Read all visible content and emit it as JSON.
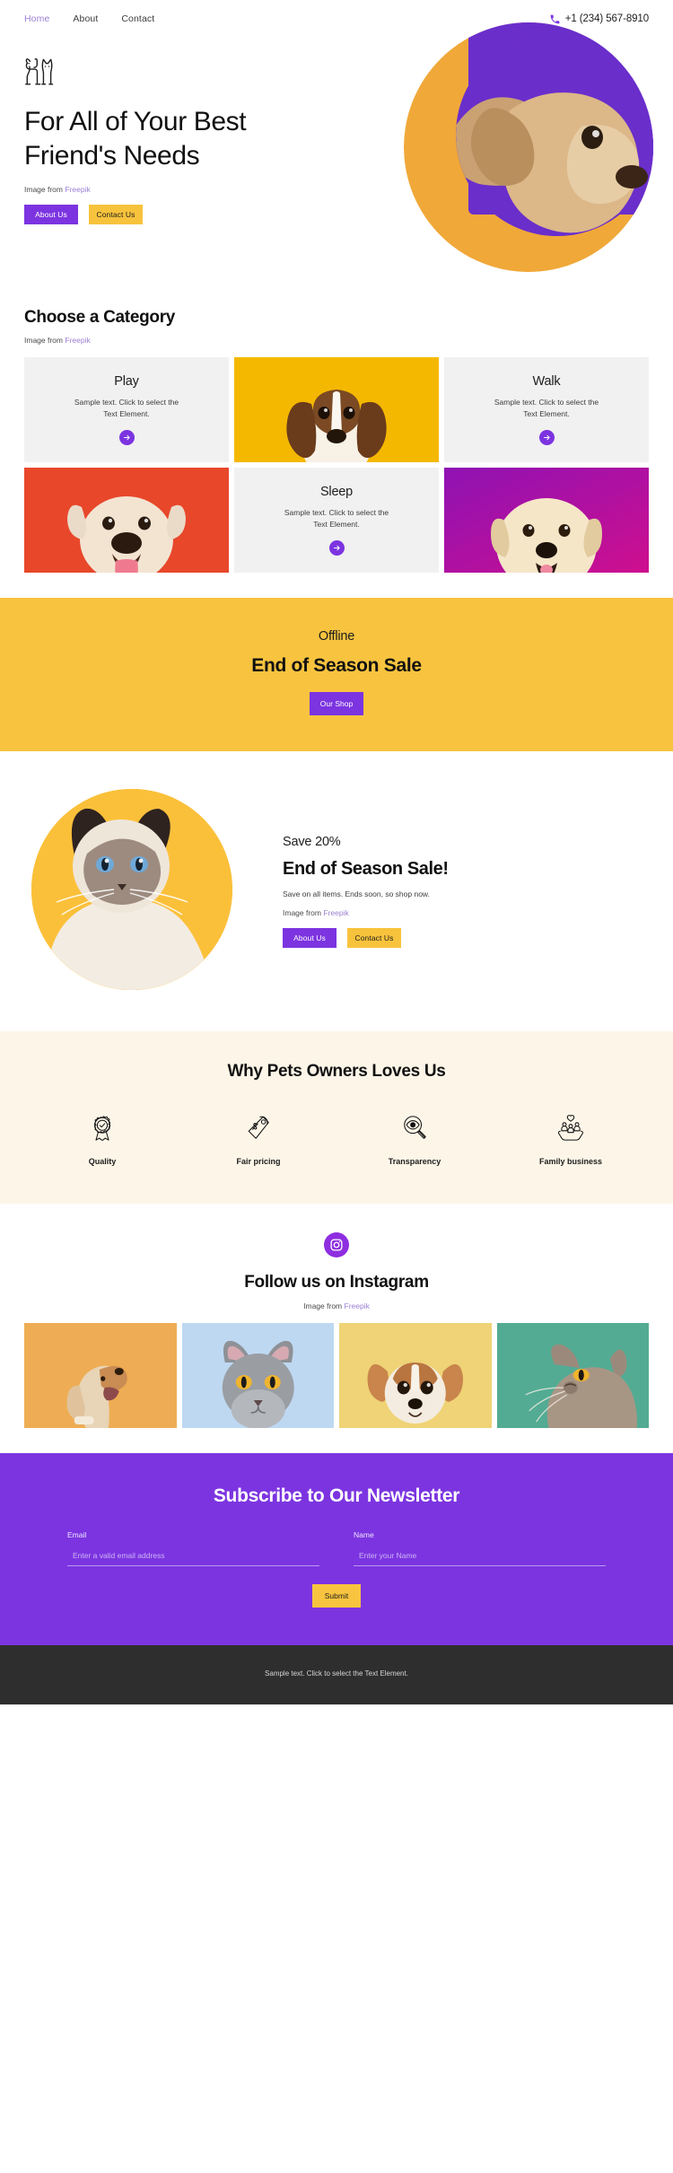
{
  "header": {
    "nav": [
      {
        "label": "Home",
        "active": true
      },
      {
        "label": "About",
        "active": false
      },
      {
        "label": "Contact",
        "active": false
      }
    ],
    "phone": "+1 (234) 567-8910",
    "phone_icon": "phone-icon"
  },
  "hero": {
    "logo_icon": "dog-and-cat-logo-icon",
    "heading": "For All of Your Best Friend's Needs",
    "credit_prefix": "Image from ",
    "credit_link": "Freepik",
    "primary_button": "About Us",
    "secondary_button": "Contact Us",
    "image_alt": "french-bulldog-photo"
  },
  "category": {
    "title": "Choose a Category",
    "credit_prefix": "Image from ",
    "credit_link": "Freepik",
    "cells": [
      {
        "kind": "text",
        "title": "Play",
        "body": "Sample text. Click to select the Text Element.",
        "arrow_icon": "arrow-right-icon"
      },
      {
        "kind": "image",
        "image_alt": "beagle-puppy-photo",
        "swatch": "#f5b800"
      },
      {
        "kind": "text",
        "title": "Walk",
        "body": "Sample text. Click to select the Text Element.",
        "arrow_icon": "arrow-right-icon"
      },
      {
        "kind": "image",
        "image_alt": "english-bulldog-photo",
        "swatch": "#e8472a"
      },
      {
        "kind": "text",
        "title": "Sleep",
        "body": "Sample text. Click to select the Text Element.",
        "arrow_icon": "arrow-right-icon"
      },
      {
        "kind": "image",
        "image_alt": "golden-retriever-puppy-photo",
        "swatch": "#b4159b"
      }
    ]
  },
  "sale_banner": {
    "kicker": "Offline",
    "title": "End of Season Sale",
    "button": "Our Shop"
  },
  "promo": {
    "image_alt": "siamese-cat-photo",
    "kicker": "Save 20%",
    "title": "End of Season Sale!",
    "text": "Save on all items. Ends soon, so shop now.",
    "credit_prefix": "Image from ",
    "credit_link": "Freepik",
    "primary_button": "About Us",
    "secondary_button": "Contact Us"
  },
  "why": {
    "title": "Why Pets Owners Loves Us",
    "items": [
      {
        "label": "Quality",
        "icon": "award-ribbon-icon"
      },
      {
        "label": "Fair pricing",
        "icon": "price-tag-dollar-icon"
      },
      {
        "label": "Transparency",
        "icon": "magnifier-eye-icon"
      },
      {
        "label": "Family business",
        "icon": "hands-holding-family-icon"
      }
    ]
  },
  "instagram": {
    "badge_icon": "instagram-icon",
    "title": "Follow us on Instagram",
    "credit_prefix": "Image from ",
    "credit_link": "Freepik",
    "photos": [
      {
        "image_alt": "howling-dog-photo",
        "swatch": "#eead54"
      },
      {
        "image_alt": "grey-british-shorthair-cat-photo",
        "swatch": "#bed8f2"
      },
      {
        "image_alt": "chihuahua-photo",
        "swatch": "#efd376"
      },
      {
        "image_alt": "cat-looking-up-photo",
        "swatch": "#53ab93"
      }
    ]
  },
  "newsletter": {
    "title": "Subscribe to Our Newsletter",
    "email_label": "Email",
    "email_placeholder": "Enter a valid email address",
    "email_value": "",
    "name_label": "Name",
    "name_placeholder": "Enter your Name",
    "name_value": "",
    "submit": "Submit"
  },
  "footer": {
    "text": "Sample text. Click to select the Text Element."
  },
  "colors": {
    "purple": "#7c34e0",
    "yellow": "#f8c43f",
    "orange": "#f0a839",
    "cream": "#fdf6e8",
    "dark": "#2e2e2e",
    "link": "#9b7fd4"
  }
}
